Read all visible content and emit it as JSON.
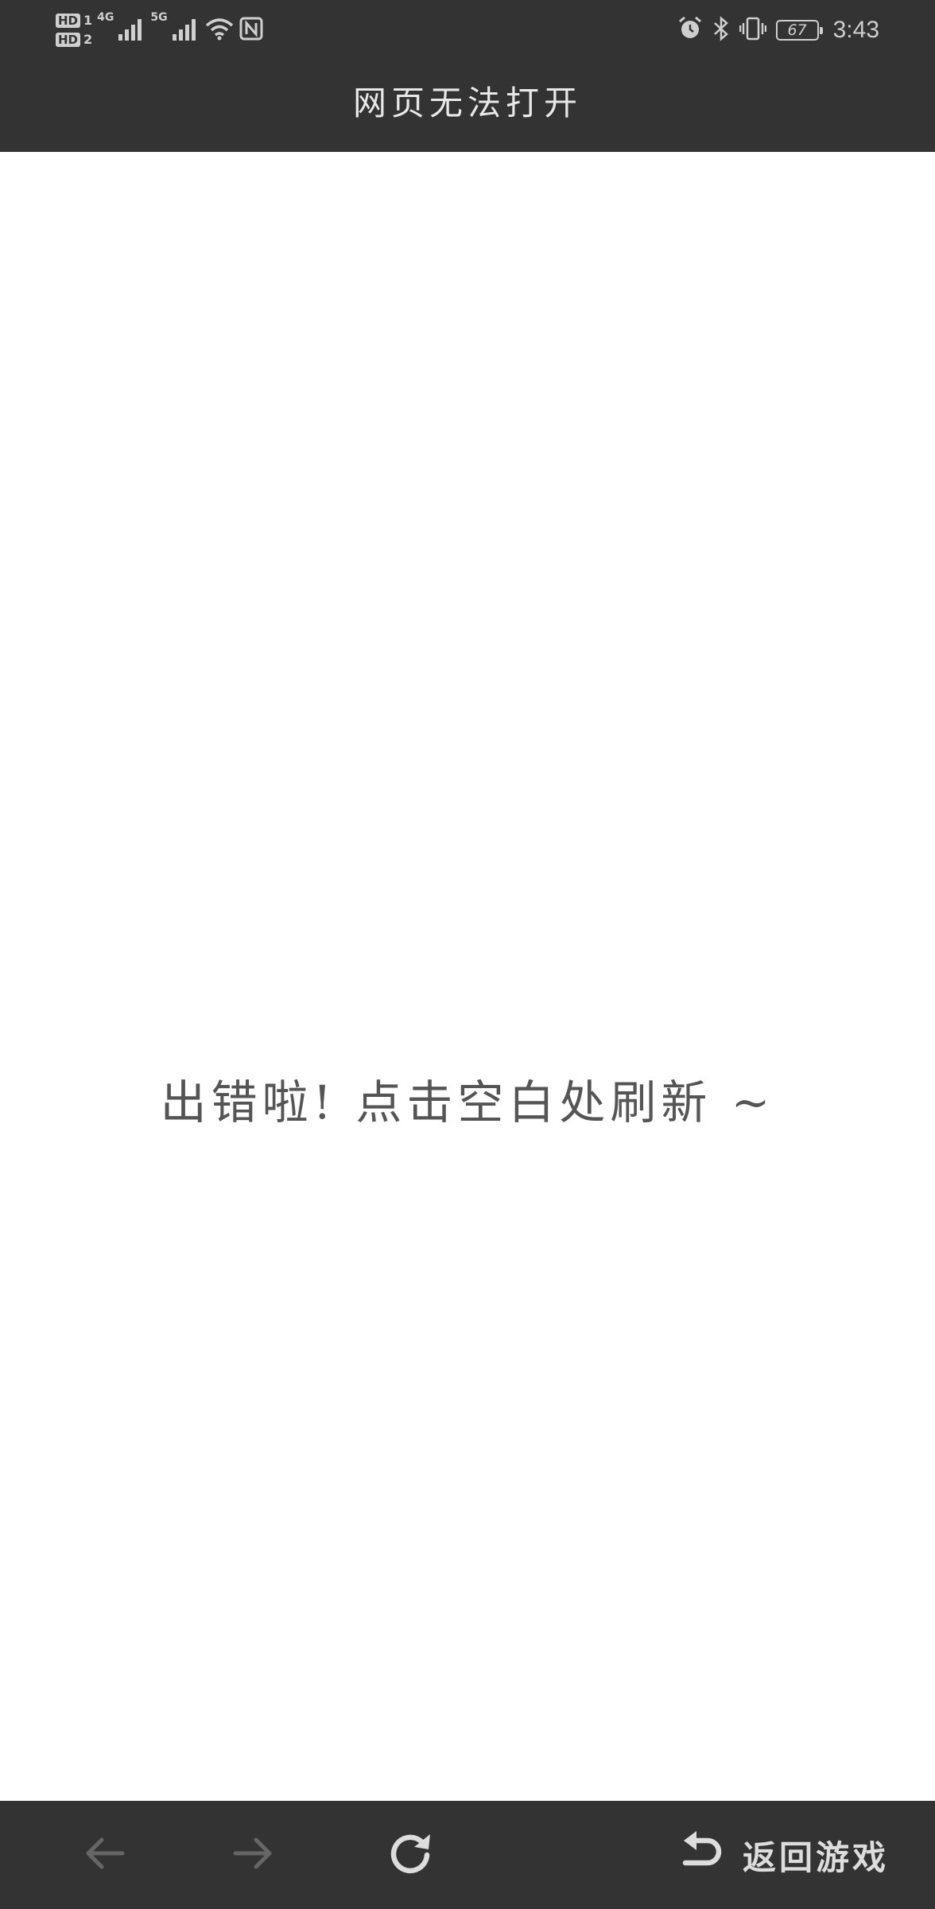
{
  "status_bar": {
    "sim1_badge": "HD",
    "sim1_number": "1",
    "sim2_badge": "HD",
    "sim2_number": "2",
    "sim1_network": "4G",
    "sim2_network": "5G",
    "battery_level": "67",
    "time": "3:43",
    "icons": [
      "signal-icon",
      "signal-icon",
      "wifi-icon",
      "nfc-icon",
      "alarm-icon",
      "bluetooth-icon",
      "vibrate-icon",
      "battery-icon"
    ]
  },
  "header": {
    "title": "网页无法打开"
  },
  "main": {
    "error_message": "出错啦! 点击空白处刷新 ~"
  },
  "bottom_bar": {
    "icons": [
      "back-arrow-icon",
      "forward-arrow-icon",
      "refresh-icon",
      "undo-return-icon"
    ],
    "return_label": "返回游戏"
  },
  "colors": {
    "bar_background": "#333333",
    "content_background": "#ffffff",
    "error_text": "#555555",
    "disabled_icon": "#666666",
    "active_icon": "#dddddd"
  }
}
